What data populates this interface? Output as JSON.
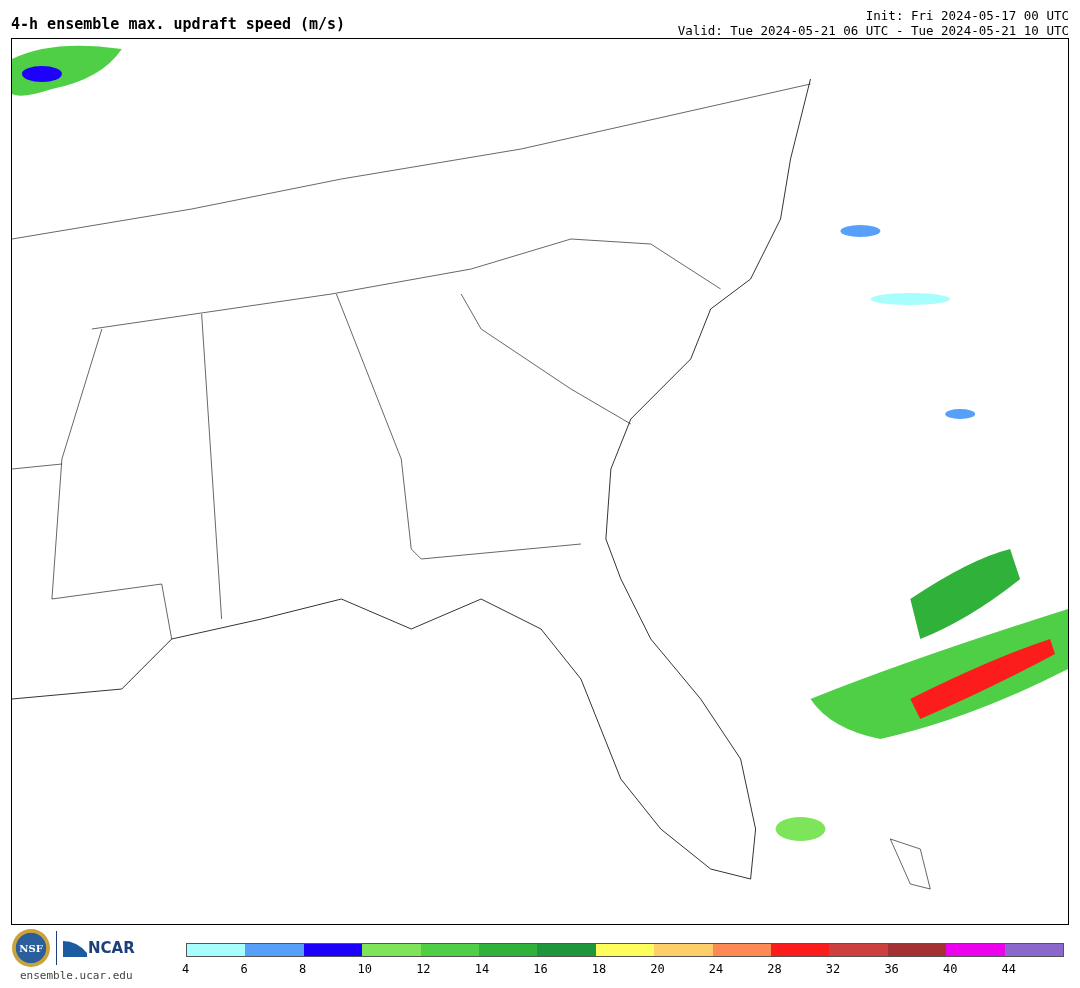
{
  "title": "4-h ensemble max. updraft speed (m/s)",
  "init": "Init: Fri 2024-05-17 00 UTC",
  "valid": "Valid: Tue 2024-05-21 06 UTC - Tue 2024-05-21 10 UTC",
  "logos": {
    "nsf": "NSF",
    "ncar": "NCAR",
    "url": "ensemble.ucar.edu"
  },
  "colorbar": {
    "segments": [
      {
        "color": "#a8fdfd"
      },
      {
        "color": "#56a0f9"
      },
      {
        "color": "#1d01fb"
      },
      {
        "color": "#7ee55a"
      },
      {
        "color": "#4fcf45"
      },
      {
        "color": "#30b13a"
      },
      {
        "color": "#1f963c"
      },
      {
        "color": "#fdfd5c"
      },
      {
        "color": "#fdce6a"
      },
      {
        "color": "#fd8a52"
      },
      {
        "color": "#fd1c1c"
      },
      {
        "color": "#cd4040"
      },
      {
        "color": "#a53232"
      },
      {
        "color": "#ec02ec"
      },
      {
        "color": "#8b68cc"
      }
    ],
    "ticks": [
      "4",
      "6",
      "8",
      "10",
      "12",
      "14",
      "16",
      "18",
      "20",
      "24",
      "28",
      "32",
      "36",
      "40",
      "44"
    ]
  }
}
